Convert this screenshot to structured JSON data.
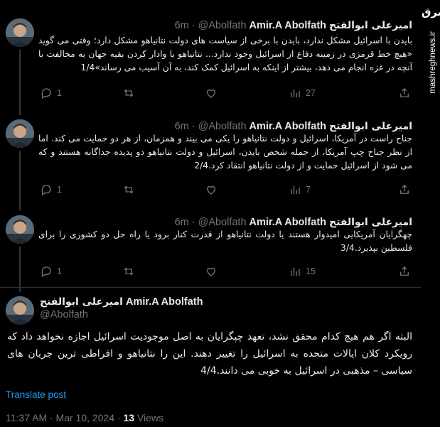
{
  "author": {
    "name_en": "Amir.A Abolfath",
    "name_fa": "امیرعلی ابوالفتح",
    "handle": "@Abolfath",
    "sep": "·",
    "time": "6m"
  },
  "thread": [
    {
      "text": "بایدن با اسرائیل مشکل ندارد، بایدن با برخی از سیاست های دولت نتانیاهو مشکل دارد؛ وقتی می گوید «هیچ خط قرمزی در زمینه دفاع از اسرائیل وجود ندارد... نتانیاهو با وادار کردن بقیه جهان به مخالفت با آنچه در غزه انجام می دهد، بیشتر از اینکه به اسرائیل کمک کند، به آن آسیب می رساند»1/4",
      "replies": "1",
      "reposts": "",
      "likes": "",
      "views": "27"
    },
    {
      "text": "جناح راست در آمریکا، اسرائیل و دولت نتانیاهو را یکی می بیند و همزمان، از هر دو حمایت می کند. اما از نظر جناح چپ آمریکا، از جمله شخص بایدن، اسرائیل و دولت نتانیاهو دو پدیده جداگانه هستند و که می شود از اسرائیل حمایت و از دولت نتانیاهو انتقاد کرد.2/4",
      "replies": "1",
      "reposts": "",
      "likes": "",
      "views": "7"
    },
    {
      "text": "چهگرایان آمریکایی امیدوار هستند یا دولت نتانیاهو از قدرت کنار برود یا راه حل دو کشوری را برای فلسطین بپذیرد.3/4",
      "replies": "1",
      "reposts": "",
      "likes": "",
      "views": "15"
    }
  ],
  "main": {
    "text": "البته اگر هم هیچ کدام محقق نشد، تعهد چپگرایان به اصل موجودیت اسرائیل اجازه نخواهد داد که رویکرد کلان ایالات متحده به اسرائیل را تغییر دهند. این را نتانیاهو و افراطی ترین جریان های سیاسی – مذهبی در اسرائیل به خوبی می دانند.4/4",
    "translate": "Translate post",
    "timestamp": "11:37 AM · Mar 10, 2024 · ",
    "views_count": "13",
    "views_label": " Views"
  },
  "watermark": {
    "logo": "مشرق",
    "site": "mashreghnews.ir"
  },
  "icons": [
    "reply-icon",
    "repost-icon",
    "like-icon",
    "views-icon",
    "share-icon"
  ],
  "colors": {
    "bg": "#000000",
    "text": "#e7e9ea",
    "muted": "#71767b",
    "link": "#1d9bf0",
    "border": "#2f3336"
  }
}
